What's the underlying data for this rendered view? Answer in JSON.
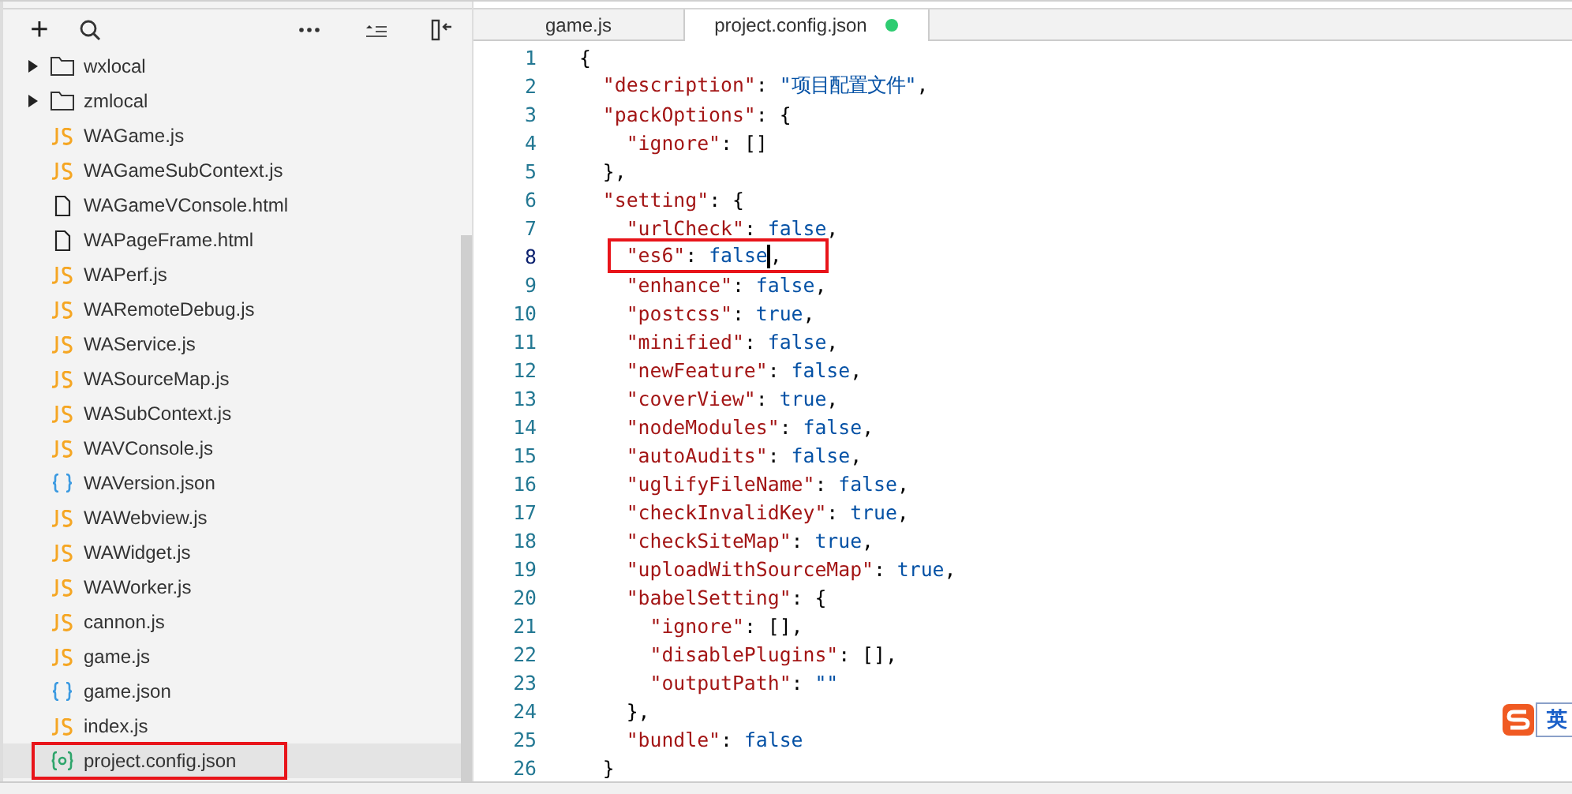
{
  "sidebar": {
    "toolbar": [
      "+"
    ],
    "tree": [
      {
        "label": "wxlocal",
        "kind": "folder",
        "selected": false,
        "highlighted": false
      },
      {
        "label": "zmlocal",
        "kind": "folder",
        "selected": false,
        "highlighted": false
      },
      {
        "label": "WAGame.js",
        "kind": "js",
        "selected": false,
        "highlighted": false
      },
      {
        "label": "WAGameSubContext.js",
        "kind": "js",
        "selected": false,
        "highlighted": false
      },
      {
        "label": "WAGameVConsole.html",
        "kind": "file",
        "selected": false,
        "highlighted": false
      },
      {
        "label": "WAPageFrame.html",
        "kind": "file",
        "selected": false,
        "highlighted": false
      },
      {
        "label": "WAPerf.js",
        "kind": "js",
        "selected": false,
        "highlighted": false
      },
      {
        "label": "WARemoteDebug.js",
        "kind": "js",
        "selected": false,
        "highlighted": false
      },
      {
        "label": "WAService.js",
        "kind": "js",
        "selected": false,
        "highlighted": false
      },
      {
        "label": "WASourceMap.js",
        "kind": "js",
        "selected": false,
        "highlighted": false
      },
      {
        "label": "WASubContext.js",
        "kind": "js",
        "selected": false,
        "highlighted": false
      },
      {
        "label": "WAVConsole.js",
        "kind": "js",
        "selected": false,
        "highlighted": false
      },
      {
        "label": "WAVersion.json",
        "kind": "json",
        "selected": false,
        "highlighted": false
      },
      {
        "label": "WAWebview.js",
        "kind": "js",
        "selected": false,
        "highlighted": false
      },
      {
        "label": "WAWidget.js",
        "kind": "js",
        "selected": false,
        "highlighted": false
      },
      {
        "label": "WAWorker.js",
        "kind": "js",
        "selected": false,
        "highlighted": false
      },
      {
        "label": "cannon.js",
        "kind": "js",
        "selected": false,
        "highlighted": false
      },
      {
        "label": "game.js",
        "kind": "js",
        "selected": false,
        "highlighted": false
      },
      {
        "label": "game.json",
        "kind": "json",
        "selected": false,
        "highlighted": false
      },
      {
        "label": "index.js",
        "kind": "js",
        "selected": false,
        "highlighted": false
      },
      {
        "label": "project.config.json",
        "kind": "config",
        "selected": true,
        "highlighted": true
      }
    ]
  },
  "tabs": [
    {
      "label": "game.js",
      "selected": false,
      "modified": false
    },
    {
      "label": "project.config.json",
      "selected": true,
      "modified": true
    }
  ],
  "editor": {
    "lines": [
      {
        "number": "1",
        "highlighted": false,
        "tokens": [
          {
            "t": "{",
            "kind": "punct"
          }
        ]
      },
      {
        "number": "2",
        "highlighted": false,
        "tokens": [
          {
            "t": "  \"description\"",
            "kind": "key"
          },
          {
            "t": ": ",
            "kind": "punct"
          },
          {
            "t": "\"项目配置文件\"",
            "kind": "value"
          },
          {
            "t": ",",
            "kind": "punct"
          }
        ]
      },
      {
        "number": "3",
        "highlighted": false,
        "tokens": [
          {
            "t": "  \"packOptions\"",
            "kind": "key"
          },
          {
            "t": ": {",
            "kind": "punct"
          }
        ]
      },
      {
        "number": "4",
        "highlighted": false,
        "tokens": [
          {
            "t": "    \"ignore\"",
            "kind": "key"
          },
          {
            "t": ": []",
            "kind": "punct"
          }
        ]
      },
      {
        "number": "5",
        "highlighted": false,
        "tokens": [
          {
            "t": "  },",
            "kind": "punct"
          }
        ]
      },
      {
        "number": "6",
        "highlighted": false,
        "tokens": [
          {
            "t": "  \"setting\"",
            "kind": "key"
          },
          {
            "t": ": {",
            "kind": "punct"
          }
        ]
      },
      {
        "number": "7",
        "highlighted": false,
        "tokens": [
          {
            "t": "    \"urlCheck\"",
            "kind": "key"
          },
          {
            "t": ": ",
            "kind": "punct"
          },
          {
            "t": "false",
            "kind": "value"
          },
          {
            "t": ",",
            "kind": "punct"
          }
        ]
      },
      {
        "number": "8",
        "highlighted": true,
        "tokens": [
          {
            "t": "    \"es6\"",
            "kind": "key"
          },
          {
            "t": ": ",
            "kind": "punct"
          },
          {
            "t": "false",
            "kind": "value"
          },
          {
            "kind": "cursor"
          },
          {
            "t": ",",
            "kind": "punct"
          }
        ]
      },
      {
        "number": "9",
        "highlighted": false,
        "tokens": [
          {
            "t": "    \"enhance\"",
            "kind": "key"
          },
          {
            "t": ": ",
            "kind": "punct"
          },
          {
            "t": "false",
            "kind": "value"
          },
          {
            "t": ",",
            "kind": "punct"
          }
        ]
      },
      {
        "number": "10",
        "highlighted": false,
        "tokens": [
          {
            "t": "    \"postcss\"",
            "kind": "key"
          },
          {
            "t": ": ",
            "kind": "punct"
          },
          {
            "t": "true",
            "kind": "value"
          },
          {
            "t": ",",
            "kind": "punct"
          }
        ]
      },
      {
        "number": "11",
        "highlighted": false,
        "tokens": [
          {
            "t": "    \"minified\"",
            "kind": "key"
          },
          {
            "t": ": ",
            "kind": "punct"
          },
          {
            "t": "false",
            "kind": "value"
          },
          {
            "t": ",",
            "kind": "punct"
          }
        ]
      },
      {
        "number": "12",
        "highlighted": false,
        "tokens": [
          {
            "t": "    \"newFeature\"",
            "kind": "key"
          },
          {
            "t": ": ",
            "kind": "punct"
          },
          {
            "t": "false",
            "kind": "value"
          },
          {
            "t": ",",
            "kind": "punct"
          }
        ]
      },
      {
        "number": "13",
        "highlighted": false,
        "tokens": [
          {
            "t": "    \"coverView\"",
            "kind": "key"
          },
          {
            "t": ": ",
            "kind": "punct"
          },
          {
            "t": "true",
            "kind": "value"
          },
          {
            "t": ",",
            "kind": "punct"
          }
        ]
      },
      {
        "number": "14",
        "highlighted": false,
        "tokens": [
          {
            "t": "    \"nodeModules\"",
            "kind": "key"
          },
          {
            "t": ": ",
            "kind": "punct"
          },
          {
            "t": "false",
            "kind": "value"
          },
          {
            "t": ",",
            "kind": "punct"
          }
        ]
      },
      {
        "number": "15",
        "highlighted": false,
        "tokens": [
          {
            "t": "    \"autoAudits\"",
            "kind": "key"
          },
          {
            "t": ": ",
            "kind": "punct"
          },
          {
            "t": "false",
            "kind": "value"
          },
          {
            "t": ",",
            "kind": "punct"
          }
        ]
      },
      {
        "number": "16",
        "highlighted": false,
        "tokens": [
          {
            "t": "    \"uglifyFileName\"",
            "kind": "key"
          },
          {
            "t": ": ",
            "kind": "punct"
          },
          {
            "t": "false",
            "kind": "value"
          },
          {
            "t": ",",
            "kind": "punct"
          }
        ]
      },
      {
        "number": "17",
        "highlighted": false,
        "tokens": [
          {
            "t": "    \"checkInvalidKey\"",
            "kind": "key"
          },
          {
            "t": ": ",
            "kind": "punct"
          },
          {
            "t": "true",
            "kind": "value"
          },
          {
            "t": ",",
            "kind": "punct"
          }
        ]
      },
      {
        "number": "18",
        "highlighted": false,
        "tokens": [
          {
            "t": "    \"checkSiteMap\"",
            "kind": "key"
          },
          {
            "t": ": ",
            "kind": "punct"
          },
          {
            "t": "true",
            "kind": "value"
          },
          {
            "t": ",",
            "kind": "punct"
          }
        ]
      },
      {
        "number": "19",
        "highlighted": false,
        "tokens": [
          {
            "t": "    \"uploadWithSourceMap\"",
            "kind": "key"
          },
          {
            "t": ": ",
            "kind": "punct"
          },
          {
            "t": "true",
            "kind": "value"
          },
          {
            "t": ",",
            "kind": "punct"
          }
        ]
      },
      {
        "number": "20",
        "highlighted": false,
        "tokens": [
          {
            "t": "    \"babelSetting\"",
            "kind": "key"
          },
          {
            "t": ": {",
            "kind": "punct"
          }
        ]
      },
      {
        "number": "21",
        "highlighted": false,
        "tokens": [
          {
            "t": "      \"ignore\"",
            "kind": "key"
          },
          {
            "t": ": [],",
            "kind": "punct"
          }
        ]
      },
      {
        "number": "22",
        "highlighted": false,
        "tokens": [
          {
            "t": "      \"disablePlugins\"",
            "kind": "key"
          },
          {
            "t": ": [],",
            "kind": "punct"
          }
        ]
      },
      {
        "number": "23",
        "highlighted": false,
        "tokens": [
          {
            "t": "      \"outputPath\"",
            "kind": "key"
          },
          {
            "t": ": ",
            "kind": "punct"
          },
          {
            "t": "\"\"",
            "kind": "value"
          }
        ]
      },
      {
        "number": "24",
        "highlighted": false,
        "tokens": [
          {
            "t": "    },",
            "kind": "punct"
          }
        ]
      },
      {
        "number": "25",
        "highlighted": false,
        "tokens": [
          {
            "t": "    \"bundle\"",
            "kind": "key"
          },
          {
            "t": ": ",
            "kind": "punct"
          },
          {
            "t": "false",
            "kind": "value"
          }
        ]
      },
      {
        "number": "26",
        "highlighted": false,
        "tokens": [
          {
            "t": "  }",
            "kind": "punct"
          }
        ]
      }
    ]
  },
  "ime": {
    "label": "英"
  }
}
